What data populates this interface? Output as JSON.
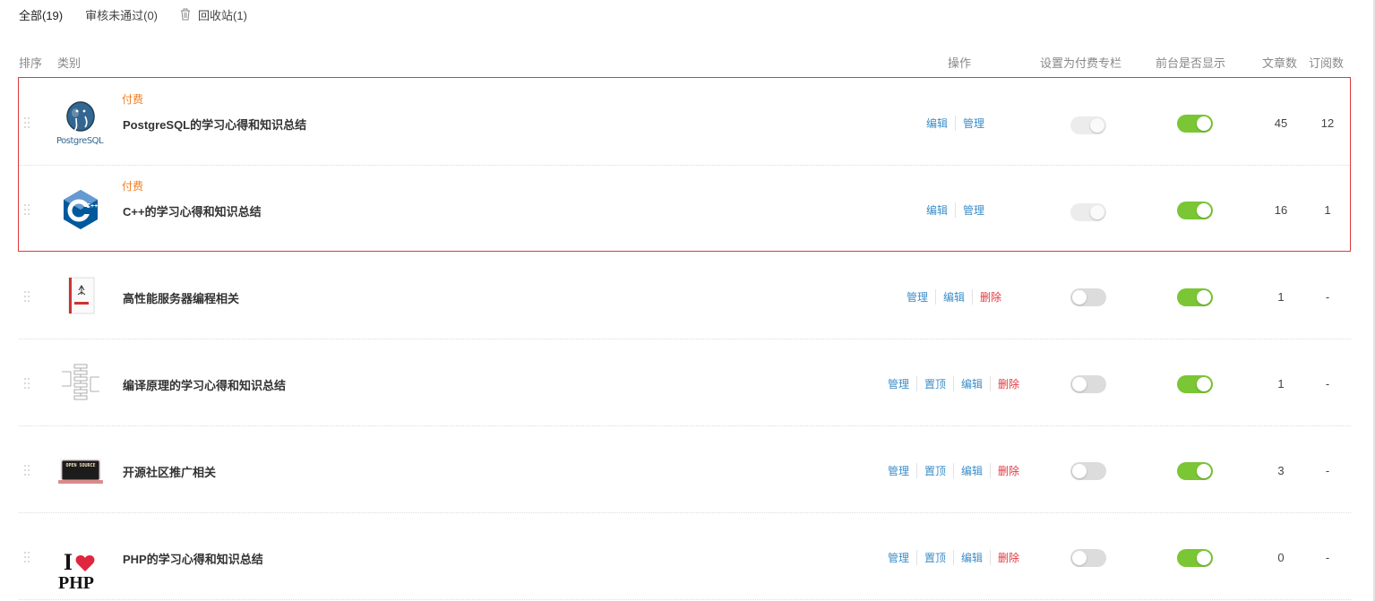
{
  "tabs": [
    {
      "label": "全部(19)"
    },
    {
      "label": "审核未通过(0)"
    },
    {
      "label": "回收站(1)"
    }
  ],
  "table_header": {
    "sort": "排序",
    "category": "类别",
    "operations": "操作",
    "set_paid": "设置为付费专栏",
    "show_front": "前台是否显示",
    "articles": "文章数",
    "subscriptions": "订阅数"
  },
  "rows": [
    {
      "badge": "付费",
      "title": "PostgreSQL的学习心得和知识总结",
      "thumb_icon": "postgresql-elephant-logo",
      "thumb_text": "PostgreSQL",
      "ops": [
        "编辑",
        "管理"
      ],
      "paid_toggle": "on-disabled",
      "show_toggle": "on",
      "articles": "45",
      "subscriptions": "12"
    },
    {
      "badge": "付费",
      "title": "C++的学习心得和知识总结",
      "thumb_icon": "cpp-hexagon-logo",
      "thumb_text": "C++",
      "ops": [
        "编辑",
        "管理"
      ],
      "paid_toggle": "on-disabled",
      "show_toggle": "on",
      "articles": "16",
      "subscriptions": "1"
    },
    {
      "title": "高性能服务器编程相关",
      "thumb_icon": "book-cover",
      "ops": [
        "管理",
        "编辑",
        "删除"
      ],
      "paid_toggle": "off",
      "show_toggle": "on",
      "articles": "1",
      "subscriptions": "-"
    },
    {
      "title": "编译原理的学习心得和知识总结",
      "thumb_icon": "compiler-diagram",
      "ops": [
        "管理",
        "置顶",
        "编辑",
        "删除"
      ],
      "paid_toggle": "off",
      "show_toggle": "on",
      "articles": "1",
      "subscriptions": "-"
    },
    {
      "title": "开源社区推广相关",
      "thumb_icon": "open-source-laptop",
      "thumb_text": "OPEN SOURCE",
      "ops": [
        "管理",
        "置顶",
        "编辑",
        "删除"
      ],
      "paid_toggle": "off",
      "show_toggle": "on",
      "articles": "3",
      "subscriptions": "-"
    },
    {
      "title": "PHP的学习心得和知识总结",
      "thumb_icon": "i-love-php-logo",
      "thumb_text": "PHP",
      "ops": [
        "管理",
        "置顶",
        "编辑",
        "删除"
      ],
      "paid_toggle": "off",
      "show_toggle": "on",
      "articles": "0",
      "subscriptions": "-"
    }
  ],
  "colors": {
    "link": "#3c8ec8",
    "delete": "#e0393e",
    "badge": "#f27c1f",
    "toggle_on": "#7ac634",
    "selection_border": "#e0393e"
  }
}
